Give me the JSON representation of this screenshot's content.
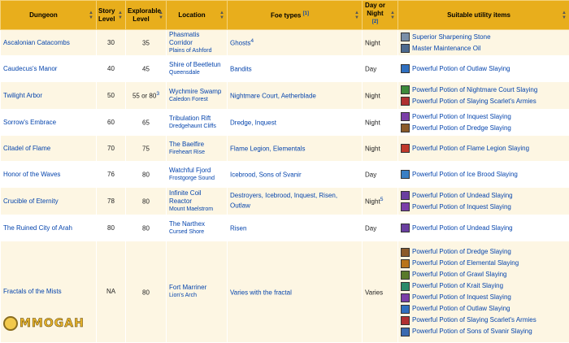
{
  "headers": [
    "Dungeon",
    "Story Level",
    "Explorable Level",
    "Location",
    "Foe types",
    "Day or Night",
    "Suitable utility items"
  ],
  "header_refs": {
    "foe": "[1]",
    "daynight": "[2]"
  },
  "rows": [
    {
      "dungeon": "Ascalonian Catacombs",
      "story": "30",
      "explorable": "35",
      "explorable_sup": "",
      "location": "Phasmatis Corridor",
      "region": "Plains of Ashford",
      "foes": "Ghosts",
      "foes_sup": "4",
      "time": "Night",
      "time_sup": "",
      "items": [
        {
          "name": "Superior Sharpening Stone",
          "icon": "sharpening-stone",
          "color": "#7a8fa8"
        },
        {
          "name": "Master Maintenance Oil",
          "icon": "maintenance-oil",
          "color": "#4d6a8f"
        }
      ]
    },
    {
      "dungeon": "Caudecus's Manor",
      "story": "40",
      "explorable": "45",
      "explorable_sup": "",
      "location": "Shire of Beetletun",
      "region": "Queensdale",
      "foes": "Bandits",
      "foes_sup": "",
      "time": "Day",
      "time_sup": "",
      "items": [
        {
          "name": "Powerful Potion of Outlaw Slaying",
          "icon": "potion-outlaw",
          "color": "#2f6fbf"
        }
      ]
    },
    {
      "dungeon": "Twilight Arbor",
      "story": "50",
      "explorable": "55 or 80",
      "explorable_sup": "3",
      "location": "Wychmire Swamp",
      "region": "Caledon Forest",
      "foes": "Nightmare Court, Aetherblade",
      "foes_sup": "",
      "time": "Night",
      "time_sup": "",
      "items": [
        {
          "name": "Powerful Potion of Nightmare Court Slaying",
          "icon": "potion-nightmare",
          "color": "#3d8a3a"
        },
        {
          "name": "Powerful Potion of Slaying Scarlet's Armies",
          "icon": "potion-scarlet",
          "color": "#b03030"
        }
      ]
    },
    {
      "dungeon": "Sorrow's Embrace",
      "story": "60",
      "explorable": "65",
      "explorable_sup": "",
      "location": "Tribulation Rift",
      "region": "Dredgehaunt Cliffs",
      "foes": "Dredge, Inquest",
      "foes_sup": "",
      "time": "Night",
      "time_sup": "",
      "items": [
        {
          "name": "Powerful Potion of Inquest Slaying",
          "icon": "potion-inquest",
          "color": "#7b3fa8"
        },
        {
          "name": "Powerful Potion of Dredge Slaying",
          "icon": "potion-dredge",
          "color": "#8a5a2a"
        }
      ]
    },
    {
      "dungeon": "Citadel of Flame",
      "story": "70",
      "explorable": "75",
      "explorable_sup": "",
      "location": "The Baelfire",
      "region": "Fireheart Rise",
      "foes": "Flame Legion, Elementals",
      "foes_sup": "",
      "time": "Night",
      "time_sup": "",
      "items": [
        {
          "name": "Powerful Potion of Flame Legion Slaying",
          "icon": "potion-flame",
          "color": "#c0392b"
        }
      ]
    },
    {
      "dungeon": "Honor of the Waves",
      "story": "76",
      "explorable": "80",
      "explorable_sup": "",
      "location": "Watchful Fjord",
      "region": "Frostgorge Sound",
      "foes": "Icebrood, Sons of Svanir",
      "foes_sup": "",
      "time": "Day",
      "time_sup": "",
      "items": [
        {
          "name": "Powerful Potion of Ice Brood Slaying",
          "icon": "potion-icebrood",
          "color": "#3a7fc4"
        }
      ]
    },
    {
      "dungeon": "Crucible of Eternity",
      "story": "78",
      "explorable": "80",
      "explorable_sup": "",
      "location": "Infinite Coil Reactor",
      "region": "Mount Maelstrom",
      "foes": "Destroyers, Icebrood, Inquest, Risen, Outlaw",
      "foes_sup": "",
      "time": "Night",
      "time_sup": "5",
      "items": [
        {
          "name": "Powerful Potion of Undead Slaying",
          "icon": "potion-undead",
          "color": "#6a3fa0"
        },
        {
          "name": "Powerful Potion of Inquest Slaying",
          "icon": "potion-inquest",
          "color": "#7b3fa8"
        }
      ]
    },
    {
      "dungeon": "The Ruined City of Arah",
      "story": "80",
      "explorable": "80",
      "explorable_sup": "",
      "location": "The Narthex",
      "region": "Cursed Shore",
      "foes": "Risen",
      "foes_sup": "",
      "time": "Day",
      "time_sup": "",
      "items": [
        {
          "name": "Powerful Potion of Undead Slaying",
          "icon": "potion-undead",
          "color": "#6a3fa0"
        }
      ]
    },
    {
      "dungeon": "Fractals of the Mists",
      "story": "NA",
      "explorable": "80",
      "explorable_sup": "",
      "location": "Fort Marriner",
      "region": "Lion's Arch",
      "foes": "Varies with the fractal",
      "foes_sup": "",
      "time": "Varies",
      "time_sup": "",
      "items": [
        {
          "name": "Powerful Potion of Dredge Slaying",
          "icon": "potion-dredge",
          "color": "#8a5a2a"
        },
        {
          "name": "Powerful Potion of Elemental Slaying",
          "icon": "potion-elemental",
          "color": "#b8741a"
        },
        {
          "name": "Powerful Potion of Grawl Slaying",
          "icon": "potion-grawl",
          "color": "#5a7a2a"
        },
        {
          "name": "Powerful Potion of Krait Slaying",
          "icon": "potion-krait",
          "color": "#2a8a6a"
        },
        {
          "name": "Powerful Potion of Inquest Slaying",
          "icon": "potion-inquest",
          "color": "#7b3fa8"
        },
        {
          "name": "Powerful Potion of Outlaw Slaying",
          "icon": "potion-outlaw",
          "color": "#2f6fbf"
        },
        {
          "name": "Powerful Potion of Slaying Scarlet's Armies",
          "icon": "potion-scarlet",
          "color": "#b03030"
        },
        {
          "name": "Powerful Potion of Sons of Svanir Slaying",
          "icon": "potion-svanir",
          "color": "#3a6ab0"
        }
      ]
    }
  ],
  "watermark": "MMOGAH"
}
